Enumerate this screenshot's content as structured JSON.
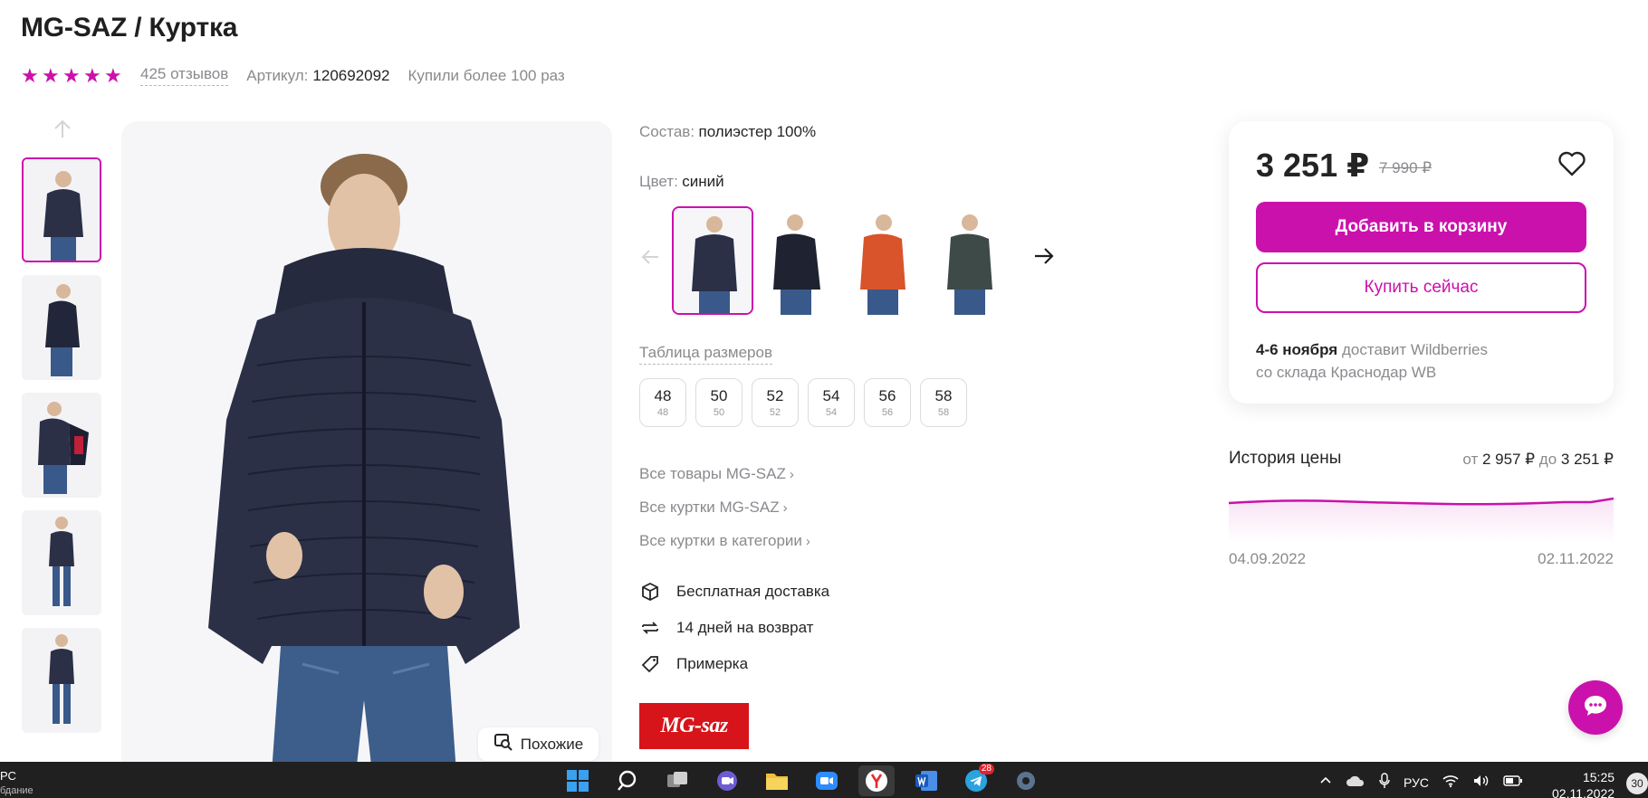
{
  "product": {
    "title": "MG-SAZ / Куртка",
    "rating_stars": 5,
    "reviews": "425 отзывов",
    "article_label": "Артикул:",
    "article_value": "120692092",
    "bought": "Купили более 100 раз"
  },
  "gallery": {
    "similar_label": "Похожие"
  },
  "details": {
    "composition_label": "Состав:",
    "composition_value": "полиэстер 100%",
    "color_label": "Цвет:",
    "color_value": "синий",
    "size_table_link": "Таблица размеров",
    "sizes": [
      {
        "big": "48",
        "small": "48"
      },
      {
        "big": "50",
        "small": "50"
      },
      {
        "big": "52",
        "small": "52"
      },
      {
        "big": "54",
        "small": "54"
      },
      {
        "big": "56",
        "small": "56"
      },
      {
        "big": "58",
        "small": "58"
      }
    ],
    "links": [
      "Все товары MG-SAZ",
      "Все куртки MG-SAZ",
      "Все куртки в категории"
    ],
    "perks": [
      "Бесплатная доставка",
      "14 дней на возврат",
      "Примерка"
    ],
    "brand_logo_text": "MG-saz"
  },
  "buy": {
    "price": "3 251 ₽",
    "old_price": "7 990 ₽",
    "add_to_cart": "Добавить в корзину",
    "buy_now": "Купить сейчас",
    "delivery_date": "4-6 ноября",
    "delivery_by": "доставит Wildberries",
    "delivery_from": "со склада Краснодар WB"
  },
  "price_history": {
    "title": "История цены",
    "from_label": "от",
    "from_value": "2 957 ₽",
    "to_label": "до",
    "to_value": "3 251 ₽",
    "date_start": "04.09.2022",
    "date_end": "02.11.2022"
  },
  "taskbar": {
    "left_line1": "РС",
    "left_line2": "бдание",
    "lang": "РУС",
    "time": "15:25",
    "date": "02.11.2022",
    "notifications": "30",
    "telegram_badge": "28"
  },
  "colors": {
    "accent": "#cb11ab",
    "jacket_navy": "#2b3047",
    "jacket_orange": "#d9542a",
    "jacket_green": "#3d4a48"
  }
}
